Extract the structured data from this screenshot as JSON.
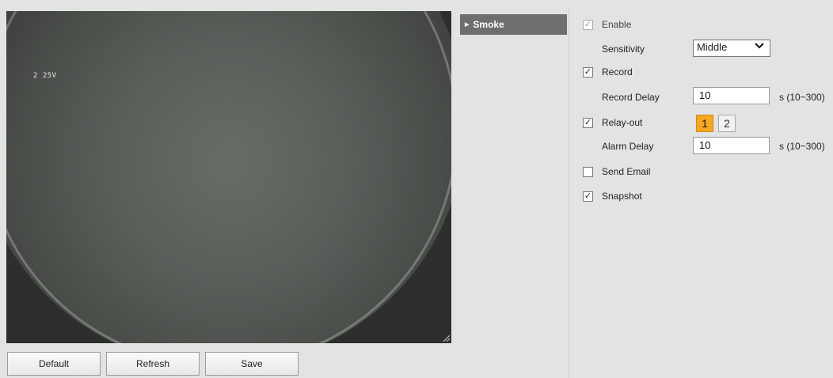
{
  "video": {
    "osd_text": "2 25V"
  },
  "buttons": {
    "default_label": "Default",
    "refresh_label": "Refresh",
    "save_label": "Save"
  },
  "tab": {
    "label": "Smoke"
  },
  "settings": {
    "enable": {
      "label": "Enable",
      "checked": true,
      "disabled": true
    },
    "sensitivity": {
      "label": "Sensitivity",
      "value": "Middle"
    },
    "record": {
      "label": "Record",
      "checked": true
    },
    "record_delay": {
      "label": "Record Delay",
      "value": "10",
      "range": "s (10~300)"
    },
    "relay_out": {
      "label": "Relay-out",
      "checked": true,
      "channels": [
        "1",
        "2"
      ],
      "active_channel": "1"
    },
    "alarm_delay": {
      "label": "Alarm Delay",
      "value": "10",
      "range": "s (10~300)"
    },
    "send_email": {
      "label": "Send Email",
      "checked": false
    },
    "snapshot": {
      "label": "Snapshot",
      "checked": true
    }
  },
  "colors": {
    "tab_bg": "#6e6e6e",
    "relay_active": "#f5a623",
    "page_bg": "#e3e3e3"
  }
}
